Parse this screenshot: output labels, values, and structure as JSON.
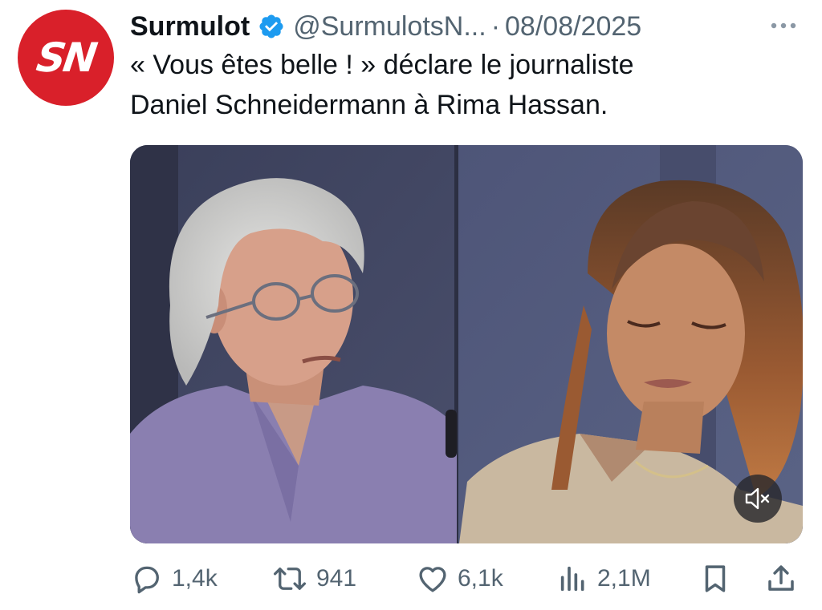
{
  "tweet": {
    "avatar_text": "SN",
    "display_name": "Surmulot",
    "handle": "@SurmulotsN...",
    "separator": "·",
    "date": "08/08/2025",
    "text_lines": [
      "« Vous êtes belle ! » déclare le journaliste",
      "Daniel Schneidermann à Rima Hassan."
    ]
  },
  "media": {
    "type": "video",
    "sound": "muted"
  },
  "actions": {
    "replies": "1,4k",
    "reposts": "941",
    "likes": "6,1k",
    "views": "2,1M"
  },
  "icons": {
    "verified": "verified-badge-icon",
    "more": "more-icon",
    "mute": "speaker-muted-icon",
    "reply": "reply-icon",
    "repost": "repost-icon",
    "like": "heart-icon",
    "views": "views-icon",
    "bookmark": "bookmark-icon",
    "share": "share-icon"
  },
  "colors": {
    "brand_red": "#d9202a",
    "verified_blue": "#1d9bf0",
    "secondary_text": "#536471",
    "primary_text": "#0f1419"
  }
}
